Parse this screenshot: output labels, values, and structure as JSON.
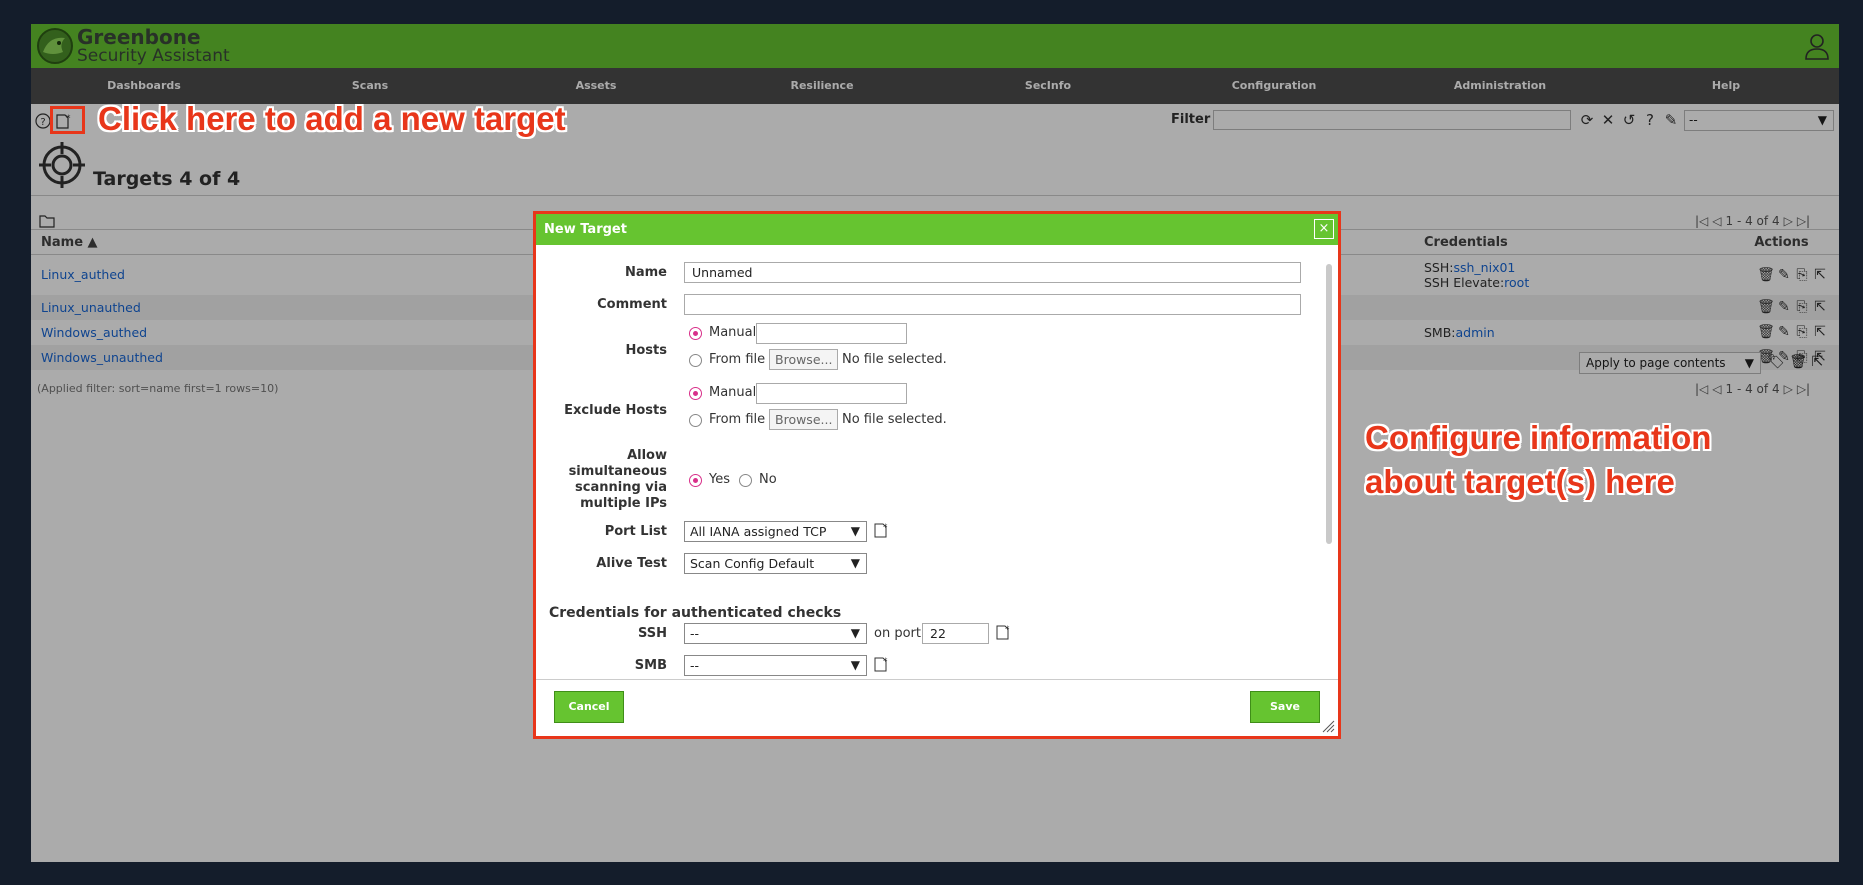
{
  "app": {
    "brand_line1": "Greenbone",
    "brand_line2": "Security Assistant",
    "accent_color": "#66c430",
    "annotation_color": "#e8361a"
  },
  "menu": [
    "Dashboards",
    "Scans",
    "Assets",
    "Resilience",
    "SecInfo",
    "Configuration",
    "Administration",
    "Help"
  ],
  "toolbar": {
    "filter_label": "Filter",
    "filter_value": "",
    "filter_select": "--"
  },
  "page": {
    "title": "Targets 4 of 4",
    "pager_top": "1 - 4 of 4",
    "pager_bottom": "1 - 4 of 4",
    "applied_filter": "(Applied filter: sort=name first=1 rows=10)",
    "bulk_select": "Apply to page contents"
  },
  "table": {
    "headers": {
      "name": "Name ▲",
      "credentials": "Credentials",
      "actions": "Actions"
    },
    "rows": [
      {
        "name": "Linux_authed",
        "cred1_prefix": "SSH:",
        "cred1_link": "ssh_nix01",
        "cred2_prefix": "SSH Elevate:",
        "cred2_link": "root"
      },
      {
        "name": "Linux_unauthed"
      },
      {
        "name": "Windows_authed",
        "cred1_prefix": "SMB:",
        "cred1_link": "admin"
      },
      {
        "name": "Windows_unauthed"
      }
    ]
  },
  "annotations": {
    "add_target": "Click here to add a new target",
    "configure_line1": "Configure information",
    "configure_line2": "about target(s) here"
  },
  "dialog": {
    "title": "New Target",
    "close": "×",
    "name_label": "Name",
    "name_value": "Unnamed",
    "comment_label": "Comment",
    "comment_value": "",
    "hosts_label": "Hosts",
    "exclude_label": "Exclude Hosts",
    "manual": "Manual",
    "from_file": "From file",
    "browse": "Browse...",
    "no_file": "No file selected.",
    "allow_l1": "Allow",
    "allow_l2": "simultaneous",
    "allow_l3": "scanning via",
    "allow_l4": "multiple IPs",
    "yes": "Yes",
    "no": "No",
    "port_list_label": "Port List",
    "port_list_value": "All IANA assigned TCP",
    "alive_test_label": "Alive Test",
    "alive_test_value": "Scan Config Default",
    "credentials_heading": "Credentials for authenticated checks",
    "ssh_label": "SSH",
    "ssh_value": "--",
    "on_port": "on port",
    "ssh_port": "22",
    "smb_label": "SMB",
    "smb_value": "--",
    "cancel": "Cancel",
    "save": "Save"
  }
}
